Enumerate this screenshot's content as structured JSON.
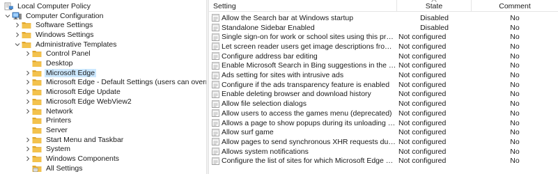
{
  "tree": {
    "items": [
      {
        "label": "Local Computer Policy",
        "icon": "policy-computer-icon",
        "expander": "none",
        "indent": 0
      },
      {
        "label": "Computer Configuration",
        "icon": "computer-icon",
        "expander": "expanded",
        "indent": 1
      },
      {
        "label": "Software Settings",
        "icon": "folder-icon",
        "expander": "collapsed",
        "indent": 2
      },
      {
        "label": "Windows Settings",
        "icon": "folder-icon",
        "expander": "collapsed",
        "indent": 2
      },
      {
        "label": "Administrative Templates",
        "icon": "folder-icon",
        "expander": "expanded",
        "indent": 2
      },
      {
        "label": "Control Panel",
        "icon": "folder-icon",
        "expander": "collapsed",
        "indent": 3
      },
      {
        "label": "Desktop",
        "icon": "folder-icon",
        "expander": "none",
        "indent": 3
      },
      {
        "label": "Microsoft Edge",
        "icon": "folder-icon",
        "expander": "collapsed",
        "indent": 3,
        "selected": true
      },
      {
        "label": "Microsoft Edge - Default Settings (users can override)",
        "icon": "folder-icon",
        "expander": "collapsed",
        "indent": 3
      },
      {
        "label": "Microsoft Edge Update",
        "icon": "folder-icon",
        "expander": "collapsed",
        "indent": 3
      },
      {
        "label": "Microsoft Edge WebView2",
        "icon": "folder-icon",
        "expander": "collapsed",
        "indent": 3
      },
      {
        "label": "Network",
        "icon": "folder-icon",
        "expander": "collapsed",
        "indent": 3
      },
      {
        "label": "Printers",
        "icon": "folder-icon",
        "expander": "none",
        "indent": 3
      },
      {
        "label": "Server",
        "icon": "folder-icon",
        "expander": "none",
        "indent": 3
      },
      {
        "label": "Start Menu and Taskbar",
        "icon": "folder-icon",
        "expander": "collapsed",
        "indent": 3
      },
      {
        "label": "System",
        "icon": "folder-icon",
        "expander": "collapsed",
        "indent": 3
      },
      {
        "label": "Windows Components",
        "icon": "folder-icon",
        "expander": "collapsed",
        "indent": 3
      },
      {
        "label": "All Settings",
        "icon": "settings-folder-icon",
        "expander": "none",
        "indent": 3
      }
    ]
  },
  "list": {
    "columns": {
      "setting": "Setting",
      "state": "State",
      "comment": "Comment"
    },
    "rows": [
      {
        "setting": "Allow the Search bar at Windows startup",
        "state": "Disabled",
        "comment": "No"
      },
      {
        "setting": "Standalone Sidebar Enabled",
        "state": "Disabled",
        "comment": "No"
      },
      {
        "setting": "Single sign-on for work or school sites using this profile ena...",
        "state": "Not configured",
        "comment": "No"
      },
      {
        "setting": "Let screen reader users get image descriptions from Microsoft",
        "state": "Not configured",
        "comment": "No"
      },
      {
        "setting": "Configure address bar editing",
        "state": "Not configured",
        "comment": "No"
      },
      {
        "setting": "Enable Microsoft Search in Bing suggestions in the address ...",
        "state": "Not configured",
        "comment": "No"
      },
      {
        "setting": "Ads setting for sites with intrusive ads",
        "state": "Not configured",
        "comment": "No"
      },
      {
        "setting": "Configure if the ads transparency feature is enabled",
        "state": "Not configured",
        "comment": "No"
      },
      {
        "setting": "Enable deleting browser and download history",
        "state": "Not configured",
        "comment": "No"
      },
      {
        "setting": "Allow file selection dialogs",
        "state": "Not configured",
        "comment": "No"
      },
      {
        "setting": "Allow users to access the games menu (deprecated)",
        "state": "Not configured",
        "comment": "No"
      },
      {
        "setting": "Allows a page to show popups during its unloading (obsolet...",
        "state": "Not configured",
        "comment": "No"
      },
      {
        "setting": "Allow surf game",
        "state": "Not configured",
        "comment": "No"
      },
      {
        "setting": "Allow pages to send synchronous XHR requests during page...",
        "state": "Not configured",
        "comment": "No"
      },
      {
        "setting": "Allows system notifications",
        "state": "Not configured",
        "comment": "No"
      },
      {
        "setting": "Configure the list of sites for which Microsoft Edge will atte...",
        "state": "Not configured",
        "comment": "No"
      }
    ]
  },
  "colors": {
    "selection": "#cce8ff",
    "folder": "#f3c24d",
    "folder_dark": "#e0a52a",
    "header_border": "#e5e5e5"
  }
}
